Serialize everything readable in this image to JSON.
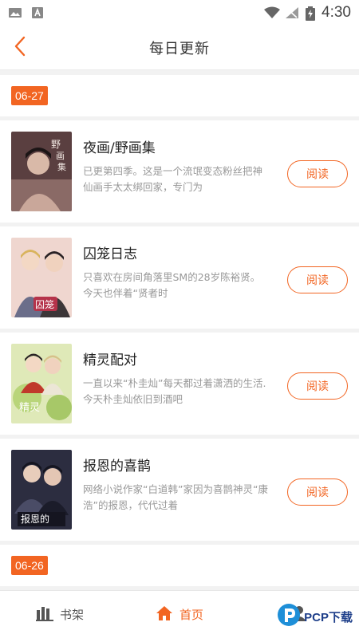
{
  "status_bar": {
    "time": "4:30",
    "icons": [
      "image-icon",
      "a-notification-icon",
      "wifi-icon",
      "no-signal-icon",
      "battery-charging-icon"
    ]
  },
  "header": {
    "title": "每日更新",
    "back_icon": "chevron-left-icon"
  },
  "sections": [
    {
      "date": "06-27",
      "books": [
        {
          "title": "夜画/野画集",
          "desc": "已更第四季。这是一个流氓变态粉丝把神仙画手太太绑回家，专门为",
          "button": "阅读",
          "cover_color": "#6b4a4a"
        },
        {
          "title": "囚笼日志",
          "desc": "只喜欢在房间角落里SM的28岁陈裕贤。 今天也伴着“贤者时",
          "button": "阅读",
          "cover_color": "#d8a8a0"
        },
        {
          "title": "精灵配对",
          "desc": "一直以来“朴圭灿”每天都过着潇洒的生活.今天朴圭灿依旧到酒吧",
          "button": "阅读",
          "cover_color": "#9fb86a"
        },
        {
          "title": "报恩的喜鹊",
          "desc": "网络小说作家“白道韩”家因为喜鹊神灵“康浩”的报恩，代代过着",
          "button": "阅读",
          "cover_color": "#2e2f44"
        }
      ]
    },
    {
      "date": "06-26",
      "books": []
    }
  ],
  "bottom_nav": {
    "items": [
      {
        "label": "书架",
        "icon": "bookshelf-icon",
        "active": false
      },
      {
        "label": "首页",
        "icon": "home-icon",
        "active": true
      },
      {
        "label": "",
        "icon": "profile-icon",
        "active": false
      }
    ]
  },
  "watermark": {
    "text": "PCP下载"
  },
  "colors": {
    "accent": "#f26522",
    "background": "#f2f2f2"
  }
}
